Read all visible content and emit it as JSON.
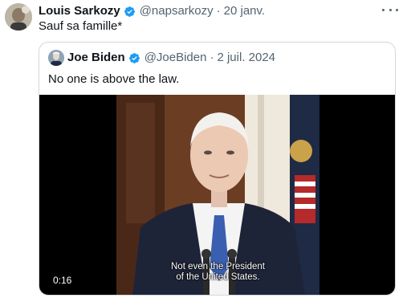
{
  "tweet": {
    "author_name": "Louis Sarkozy",
    "handle": "@napsarkozy",
    "separator": "·",
    "date": "20 janv.",
    "text": "Sauf sa famille*",
    "avatar_icon": "profile-photo",
    "verified_icon": "verified-badge-icon",
    "more_icon": "more-options-icon"
  },
  "quote": {
    "author_name": "Joe Biden",
    "handle": "@JoeBiden",
    "separator": "·",
    "date": "2 juil. 2024",
    "text": "No one is above the law.",
    "avatar_icon": "profile-photo",
    "verified_icon": "verified-badge-icon",
    "video": {
      "caption_line1": "Not even the President",
      "caption_line2": "of the United States.",
      "duration": "0:16"
    }
  },
  "colors": {
    "text_primary": "#0f1419",
    "text_muted": "#536471",
    "verified_blue": "#1d9bf0",
    "border": "#cfd9de"
  }
}
